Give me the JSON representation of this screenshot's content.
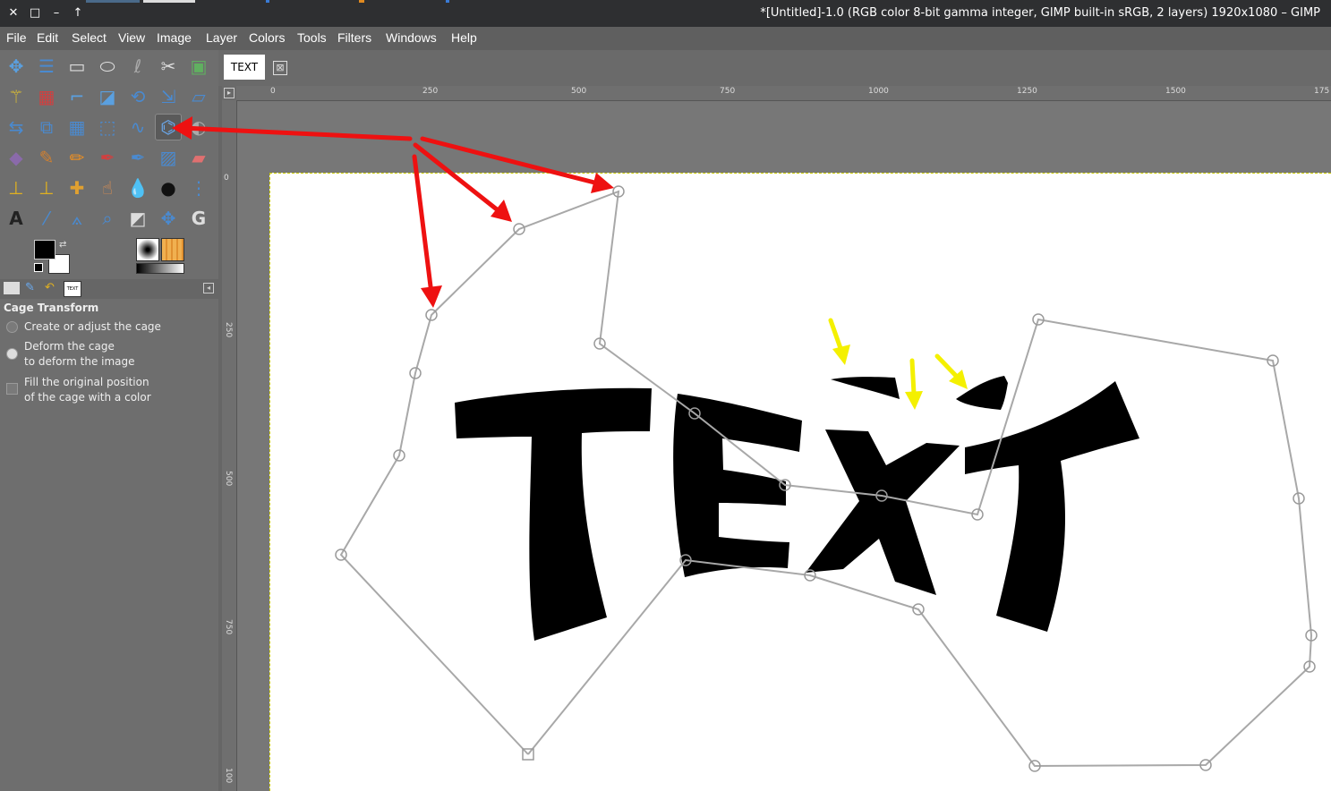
{
  "window": {
    "title": "*[Untitled]-1.0 (RGB color 8-bit gamma integer, GIMP built-in sRGB, 2 layers) 1920x1080 – GIMP",
    "close_glyph": "✕",
    "restore_glyph": "□",
    "minimize_glyph": "–",
    "keepabove_glyph": "↑"
  },
  "menu": [
    "File",
    "Edit",
    "Select",
    "View",
    "Image",
    "Layer",
    "Colors",
    "Tools",
    "Filters",
    "Windows",
    "Help"
  ],
  "image_tab": {
    "label": "TEXT",
    "close_glyph": "⊠"
  },
  "ruler": {
    "h_labels": [
      "0",
      "250",
      "500",
      "750",
      "1000",
      "1250",
      "1500",
      "175"
    ],
    "v_labels": [
      "0",
      "250",
      "500",
      "750",
      "100"
    ]
  },
  "tool_options": {
    "title": "Cage Transform",
    "mode_create": "Create or adjust the cage",
    "mode_deform_line1": "Deform the cage",
    "mode_deform_line2": "to deform the image",
    "fill_line1": "Fill the original position",
    "fill_line2": "of the cage with a color"
  },
  "canvas_text": "TEXT",
  "tools": [
    [
      "move-tool",
      "align-tool",
      "rect-select-tool",
      "ellipse-select-tool",
      "free-select-tool",
      "scissors-select-tool",
      "foreground-select-tool"
    ],
    [
      "fuzzy-select-tool",
      "color-select-tool",
      "crop-tool",
      "unified-transform-tool",
      "rotate-tool",
      "scale-tool",
      "shear-tool"
    ],
    [
      "flip-tool",
      "perspective-tool",
      "3d-transform-tool",
      "handle-transform-tool",
      "warp-transform-tool",
      "cage-transform-tool",
      "extra-tool"
    ],
    [
      "bucket-fill-tool",
      "paintbrush-tool",
      "pencil-tool",
      "airbrush-tool",
      "ink-tool",
      "mypaint-brush-tool",
      "eraser-tool"
    ],
    [
      "clone-tool",
      "perspective-clone-tool",
      "heal-tool",
      "smudge-tool",
      "blur-tool",
      "dodge-tool",
      "paths-tool"
    ],
    [
      "text-tool",
      "color-picker-tool",
      "measure-tool",
      "zoom-tool",
      "curves-tool",
      "offset-tool",
      "gegl-tool"
    ]
  ],
  "colors": {
    "accent_arrow": "#ee1111",
    "accent_yellow": "#f4f000",
    "cage_line": "#a8a8a8"
  }
}
